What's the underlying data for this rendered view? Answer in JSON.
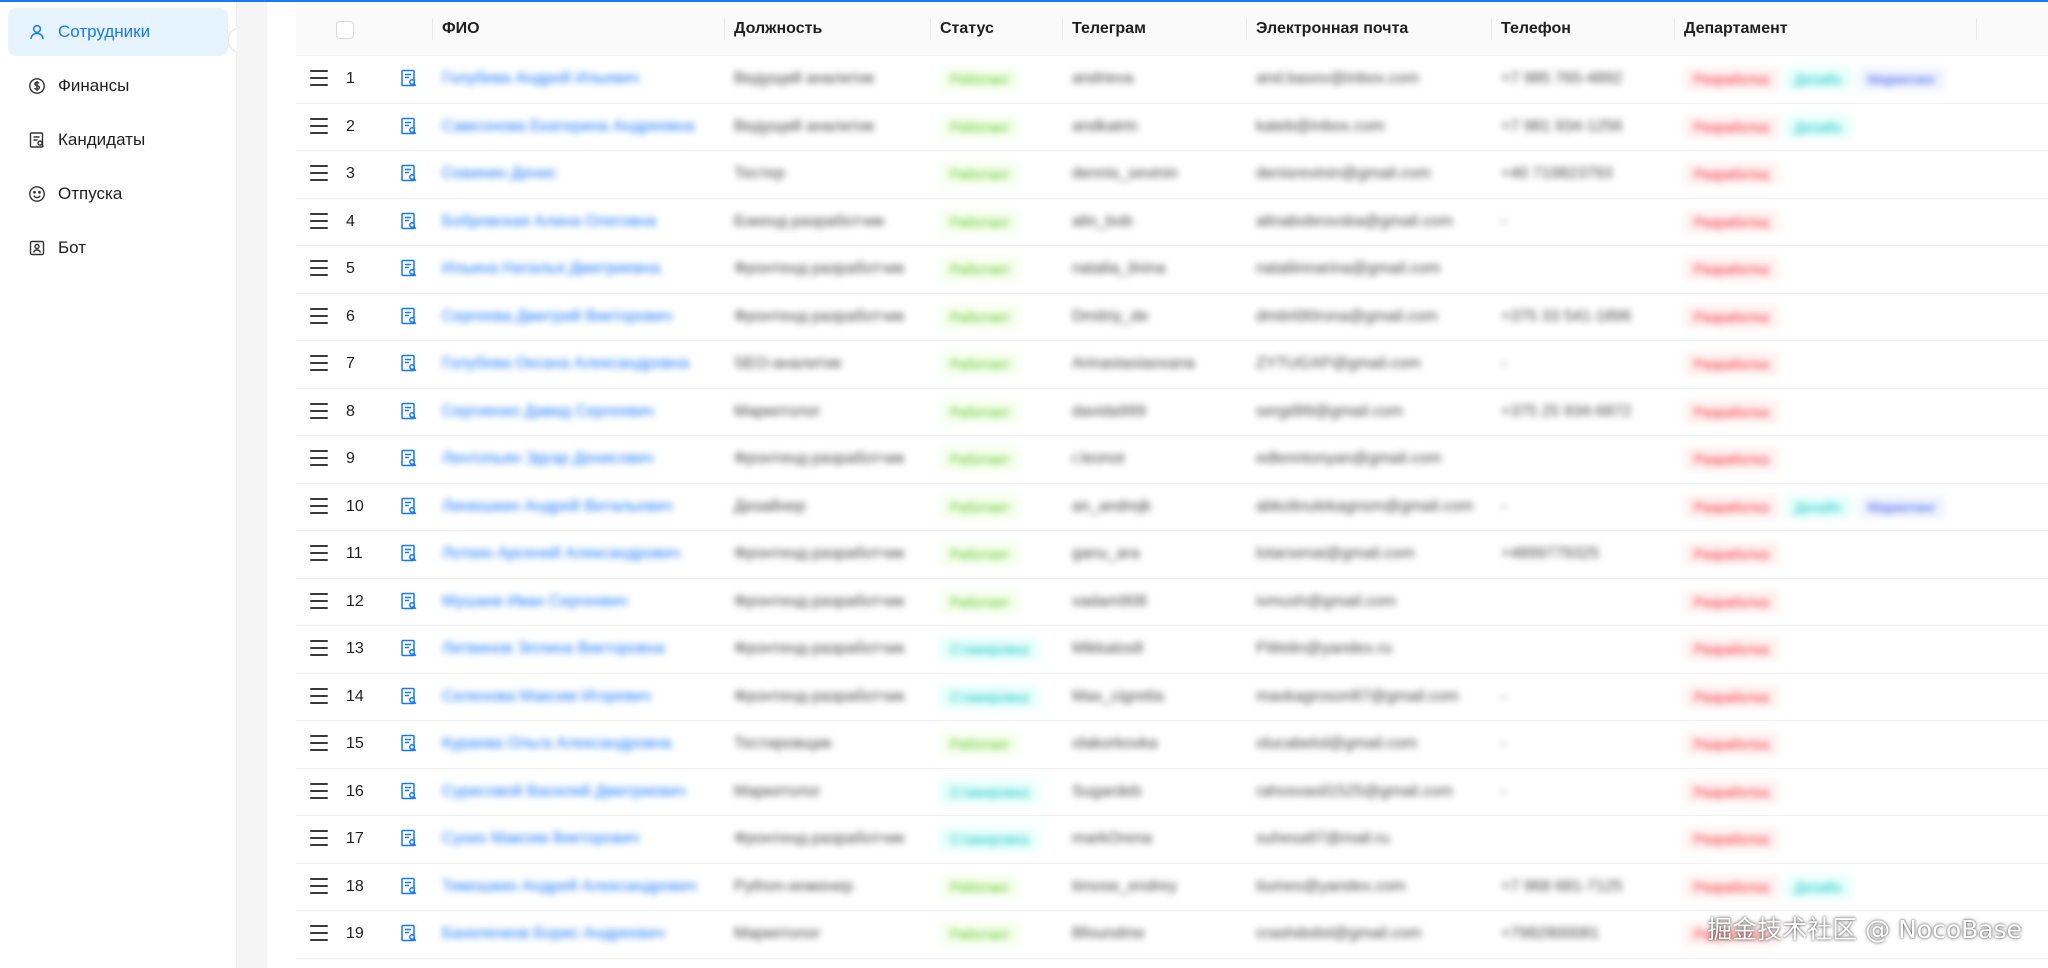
{
  "sidebar": {
    "items": [
      {
        "label": "Сотрудники",
        "icon": "user-icon",
        "active": true
      },
      {
        "label": "Финансы",
        "icon": "dollar-circle-icon",
        "active": false
      },
      {
        "label": "Кандидаты",
        "icon": "resume-icon",
        "active": false
      },
      {
        "label": "Отпуска",
        "icon": "smile-icon",
        "active": false
      },
      {
        "label": "Бот",
        "icon": "robot-icon",
        "active": false
      }
    ]
  },
  "table": {
    "headers": {
      "fio": "ФИО",
      "position": "Должность",
      "status": "Статус",
      "telegram": "Телеграм",
      "email": "Электронная почта",
      "phone": "Телефон",
      "department": "Департамент"
    },
    "rows": [
      {
        "num": "1",
        "fio": "Голубева Андрей Ильевич",
        "position": "Ведущий аналитик",
        "status": "Работает",
        "telegram": "andrieva",
        "email": "and.basov@inbox.com",
        "phone": "+7 985 765-4892",
        "departments": [
          "Разработка",
          "Дизайн",
          "Маркетинг"
        ]
      },
      {
        "num": "2",
        "fio": "Самсонова Екатерина Андреевна",
        "position": "Ведущий аналитик",
        "status": "Работает",
        "telegram": "andkatrin",
        "email": "kateb@inbox.com",
        "phone": "+7 981 934-1256",
        "departments": [
          "Разработка",
          "Дизайн"
        ]
      },
      {
        "num": "3",
        "fio": "Севинин Денис",
        "position": "Тестер",
        "status": "Работает",
        "telegram": "dennis_sevinin",
        "email": "denisrevinin@gmail.com",
        "phone": "+40 719823793",
        "departments": [
          "Разработка"
        ]
      },
      {
        "num": "4",
        "fio": "Бобровская Алина Олеговна",
        "position": "Бэкенд-разработчик",
        "status": "Работает",
        "telegram": "alin_bob",
        "email": "alinabobrovska@gmail.com",
        "phone": "-",
        "departments": [
          "Разработка"
        ]
      },
      {
        "num": "5",
        "fio": "Ильина Наталья Дмитриевна",
        "position": "Фронтенд-разработчик",
        "status": "Работает",
        "telegram": "natalia_ilnina",
        "email": "nataliinnarina@gmail.com",
        "phone": "",
        "departments": [
          "Разработка"
        ]
      },
      {
        "num": "6",
        "fio": "Сергеева Дмитрий Викторович",
        "position": "Фронтенд-разработчик",
        "status": "Работает",
        "telegram": "Dmitriy_de",
        "email": "dmitrii90rona@gmail.com",
        "phone": "+375 33 541-1896",
        "departments": [
          "Разработка"
        ]
      },
      {
        "num": "7",
        "fio": "Голубева Оксана Александровна",
        "position": "SEO-аналитик",
        "status": "Работает",
        "telegram": "Arinastasiaoxana",
        "email": "ZYTUGXP@gmail.com",
        "phone": "-",
        "departments": [
          "Разработка"
        ]
      },
      {
        "num": "8",
        "fio": "Сергиенко Давид Сергеевич",
        "position": "Маркетолог",
        "status": "Работает",
        "telegram": "davida999",
        "email": "sergd99@gmail.com",
        "phone": "+375 25 934-6872",
        "departments": [
          "Разработка"
        ]
      },
      {
        "num": "9",
        "fio": "Лентопьян Эдгар Денисович",
        "position": "Фронтенд-разработчик",
        "status": "Работает",
        "telegram": "r.leonot",
        "email": "edlenntonyan@gmail.com",
        "phone": "",
        "departments": [
          "Разработка"
        ]
      },
      {
        "num": "10",
        "fio": "Линюшкин Андрей Витальевич",
        "position": "Дизайнер",
        "status": "Работает",
        "telegram": "an_andrejk",
        "email": "abkolinulekagnsm@gmail.com",
        "phone": "-",
        "departments": [
          "Разработка",
          "Дизайн",
          "Маркетинг"
        ]
      },
      {
        "num": "11",
        "fio": "Лоткин Арсений Александрович",
        "position": "Фронтенд-разработчик",
        "status": "Работает",
        "telegram": "ganu_ara",
        "email": "lotarsenai@gmail.com",
        "phone": "+4899779325",
        "departments": [
          "Разработка"
        ]
      },
      {
        "num": "12",
        "fio": "Мушаев Иван Сергеевич",
        "position": "Фронтенд-разработчик",
        "status": "Работает",
        "telegram": "vadam908",
        "email": "ivmush@gmail.com",
        "phone": "",
        "departments": [
          "Разработка"
        ]
      },
      {
        "num": "13",
        "fio": "Литвинов Эллина Викторовна",
        "position": "Фронтенд-разработчик",
        "status": "Стажировка",
        "telegram": "Mikkalos8",
        "email": "FWelin@yandex.ru",
        "phone": "",
        "departments": [
          "Разработка"
        ]
      },
      {
        "num": "14",
        "fio": "Селенова Максим Игоревич",
        "position": "Фронтенд-разработчик",
        "status": "Стажировка",
        "telegram": "Max_cigretta",
        "email": "maxkagroson87@gmail.com",
        "phone": "-",
        "departments": [
          "Разработка"
        ]
      },
      {
        "num": "15",
        "fio": "Кураева Ольга Александровна",
        "position": "Тестировщик",
        "status": "Работает",
        "telegram": "olakorkovka",
        "email": "olucabelol@gmail.com",
        "phone": "-",
        "departments": [
          "Разработка"
        ]
      },
      {
        "num": "16",
        "fio": "Сурисовой Василий Дмитриевич",
        "position": "Маркетолог",
        "status": "Стажировка",
        "telegram": "Sugardeb",
        "email": "rahosvasil1525@gmail.com",
        "phone": "-",
        "departments": [
          "Разработка"
        ]
      },
      {
        "num": "17",
        "fio": "Сухих Максим Викторович",
        "position": "Фронтенд-разработчик",
        "status": "Стажировка",
        "telegram": "markOrena",
        "email": "suhesa97@mail.ru",
        "phone": "",
        "departments": [
          "Разработка"
        ]
      },
      {
        "num": "18",
        "fio": "Тимошкин Андрей Александрович",
        "position": "Python-инженер",
        "status": "Работает",
        "telegram": "timose_endrey",
        "email": "tiumes@yandex.com",
        "phone": "+7 968 681-7125",
        "departments": [
          "Разработка",
          "Дизайн"
        ]
      },
      {
        "num": "19",
        "fio": "Бахеленков Борис Андреевич",
        "position": "Маркетолог",
        "status": "Работает",
        "telegram": "Bfoundme",
        "email": "crashdoilol@gmail.com",
        "phone": "+7982800081",
        "departments": [
          "Разработка"
        ]
      }
    ]
  },
  "status_colors": {
    "Работает": {
      "bg": "#f6ffed",
      "fg": "#52c41a"
    },
    "Стажировка": {
      "bg": "#e6fffb",
      "fg": "#13c2c2"
    }
  },
  "department_colors": {
    "Разработка": {
      "bg": "#fff1f0",
      "fg": "#f5222d"
    },
    "Дизайн": {
      "bg": "#e6fffb",
      "fg": "#13c2c2"
    },
    "Маркетинг": {
      "bg": "#f0f5ff",
      "fg": "#2f54eb"
    }
  },
  "watermark": "掘金技术社区 @ NocoBase",
  "accent_color": "#1677ff"
}
